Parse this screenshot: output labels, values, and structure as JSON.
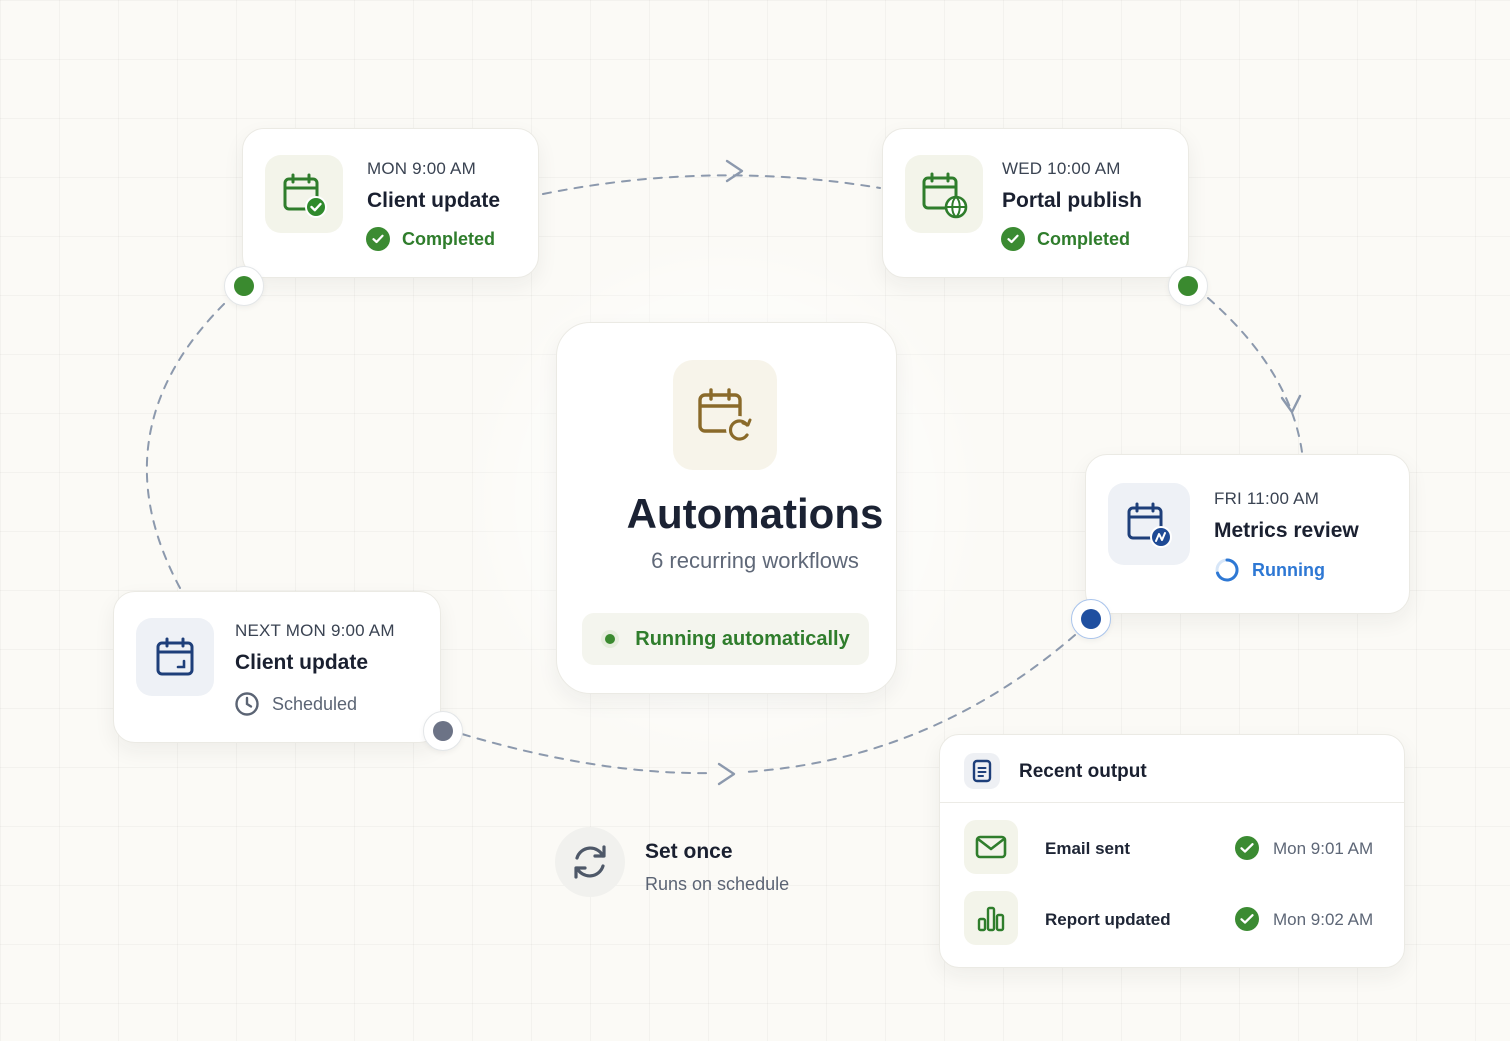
{
  "accent_colors": {
    "completed": "#2f7d2c",
    "running": "#2e78d4",
    "scheduled": "#5b6474",
    "automation_icon": "#8a6a2a"
  },
  "center": {
    "icon": "calendar-sync-icon",
    "title": "Automations",
    "subtitle": "6 recurring workflows",
    "status": "Running automatically"
  },
  "steps": [
    {
      "time": "MON 9:00 AM",
      "title": "Client update",
      "status": "Completed",
      "icon": "calendar-check-icon"
    },
    {
      "time": "WED 10:00 AM",
      "title": "Portal publish",
      "status": "Completed",
      "icon": "calendar-globe-icon"
    },
    {
      "time": "FRI 11:00 AM",
      "title": "Metrics review",
      "status": "Running",
      "icon": "calendar-metrics-icon"
    },
    {
      "time": "NEXT MON 9:00 AM",
      "title": "Client update",
      "status": "Scheduled",
      "icon": "calendar-icon"
    }
  ],
  "recent_output": {
    "title": "Recent output",
    "items": [
      {
        "label": "Email sent",
        "time": "Mon 9:01 AM",
        "icon": "mail-icon"
      },
      {
        "label": "Report updated",
        "time": "Mon 9:02 AM",
        "icon": "bar-chart-icon"
      }
    ]
  },
  "set_once": {
    "title": "Set once",
    "subtitle": "Runs on schedule",
    "icon": "refresh-icon"
  }
}
